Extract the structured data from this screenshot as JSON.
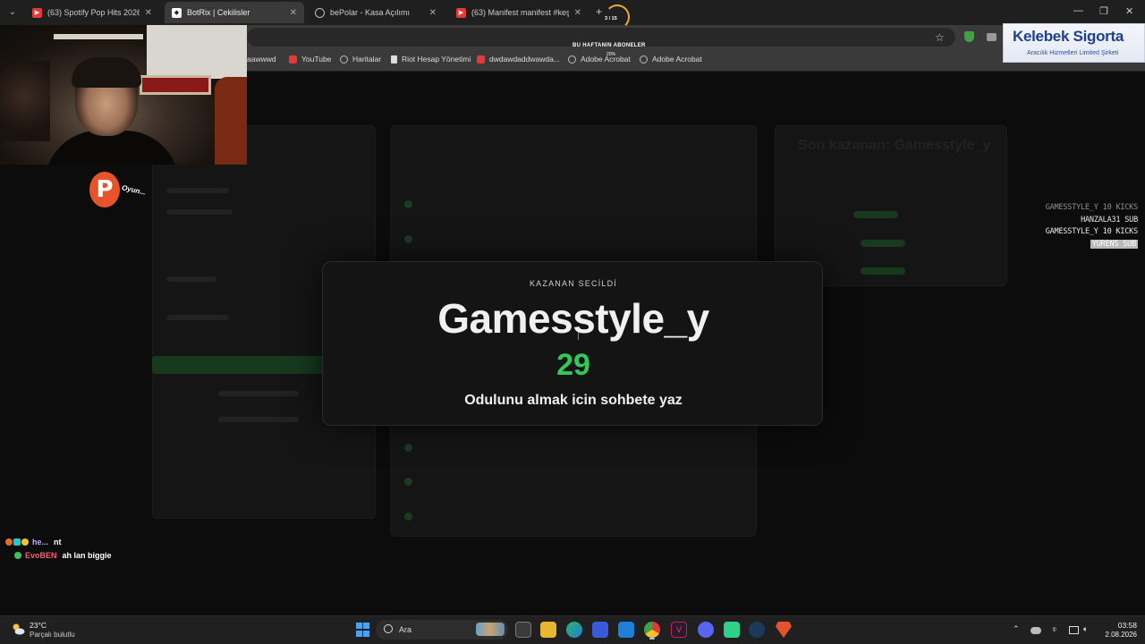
{
  "browser": {
    "tabs": [
      {
        "title": "(63) Spotify Pop Hits 2026 ♫ La",
        "favicon": "youtube-icon",
        "active": false
      },
      {
        "title": "BotRix | Cekilisler",
        "favicon": "botrix-icon",
        "active": true
      },
      {
        "title": "bePolar - Kasa Açılımı",
        "favicon": "globe-icon",
        "active": false
      },
      {
        "title": "(63) Manifest manifest #keşfet",
        "favicon": "youtube-icon",
        "active": false
      }
    ],
    "bookmarks": [
      {
        "label": "aawwwd",
        "icon": "globe-icon"
      },
      {
        "label": "YouTube",
        "icon": "youtube-icon"
      },
      {
        "label": "Haritalar",
        "icon": "maps-icon"
      },
      {
        "label": "Riot Hesap Yönetimi",
        "icon": "riot-icon"
      },
      {
        "label": "dwdawdaddwawda...",
        "icon": "youtube-icon"
      },
      {
        "label": "Adobe Acrobat",
        "icon": "globe-icon"
      },
      {
        "label": "Adobe Acrobat",
        "icon": "globe-icon"
      }
    ]
  },
  "overlay": {
    "subs_header": "BU HAFTANIN ABONELER",
    "sub_counter": "3 / 15",
    "sub_percent": "20%",
    "sponsor": {
      "brand": "Kelebek Sigorta",
      "subtitle": "Aracılık Hizmetleri Limited Şirketi"
    },
    "logo_letter": "P",
    "logo_text": "Oyun...",
    "feed": [
      {
        "text": "GAMESSTYLE_Y 10 KICKS",
        "style": "dim"
      },
      {
        "text": "HANZALA31 SUB",
        "style": "normal"
      },
      {
        "text": "GAMESSTYLE_Y 10 KICKS",
        "style": "normal"
      },
      {
        "text": "YURENS SUB",
        "style": "highlight"
      }
    ]
  },
  "dashboard": {
    "ghost_title": "Son kazanan: Gamesstyle_y"
  },
  "winner_modal": {
    "kicker": "KAZANAN SECİLDİ",
    "winner_name": "Gamesstyle_y",
    "number": "29",
    "message": "Odulunu almak icin sohbete yaz"
  },
  "chat": [
    {
      "user": "he...",
      "text": "nt",
      "user_color": "#c7a5ff"
    },
    {
      "user": "EvoBEN",
      "text": "ah lan biggie",
      "user_color": "#ff5a6a"
    }
  ],
  "taskbar": {
    "weather_temp": "23°C",
    "weather_desc": "Parçalı bulutlu",
    "search_label": "Ara",
    "time": "03:58",
    "date": "2.08.2026"
  },
  "colors": {
    "accent_green": "#33c85a",
    "sponsor_blue": "#1f3f8f",
    "chrome_dark": "#3a3a3a"
  }
}
